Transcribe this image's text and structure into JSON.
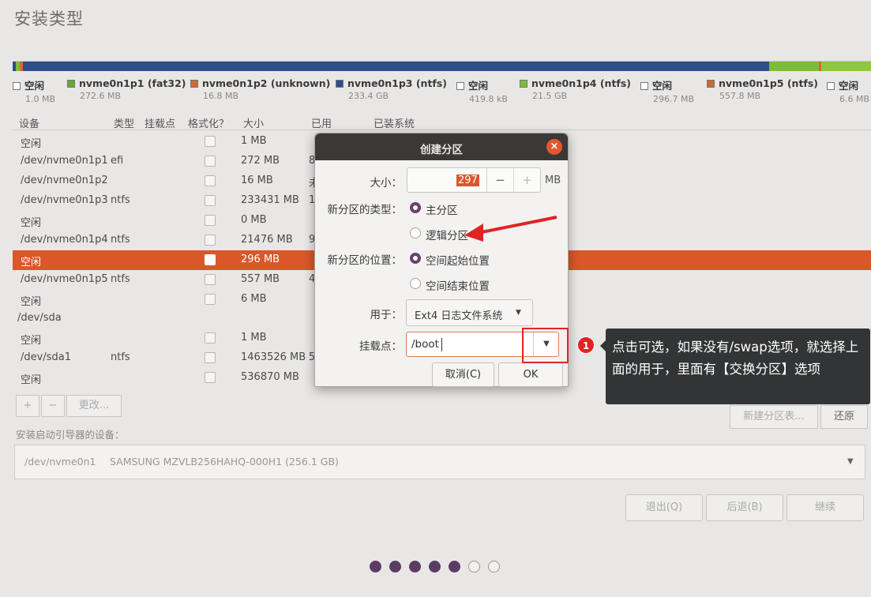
{
  "page_title": "安装类型",
  "partition_bar": [
    {
      "color": "#2d4f8a",
      "weight": 0.4
    },
    {
      "color": "#7bbd3a",
      "weight": 0.5
    },
    {
      "color": "#d06c2e",
      "weight": 0.3
    },
    {
      "color": "#2d4f8a",
      "weight": 90
    },
    {
      "color": "#7bbd3a",
      "weight": 6
    },
    {
      "color": "#d06c2e",
      "weight": 0.3
    },
    {
      "color": "#8ec63f",
      "weight": 6
    }
  ],
  "legend": [
    {
      "name": "空闲",
      "size": "1.0 MB",
      "color": "#ffffff"
    },
    {
      "name": "nvme0n1p1 (fat32)",
      "size": "272.6 MB",
      "color": "#6aa82d"
    },
    {
      "name": "nvme0n1p2 (unknown)",
      "size": "16.8 MB",
      "color": "#cc6a36"
    },
    {
      "name": "nvme0n1p3 (ntfs)",
      "size": "233.4 GB",
      "color": "#2d4f8a"
    },
    {
      "name": "空闲",
      "size": "419.8 kB",
      "color": "#ffffff"
    },
    {
      "name": "nvme0n1p4 (ntfs)",
      "size": "21.5 GB",
      "color": "#7bbd3a"
    },
    {
      "name": "空闲",
      "size": "296.7 MB",
      "color": "#ffffff"
    },
    {
      "name": "nvme0n1p5 (ntfs)",
      "size": "557.8 MB",
      "color": "#cc6a36"
    },
    {
      "name": "空闲",
      "size": "6.6 MB",
      "color": "#ffffff"
    }
  ],
  "table": {
    "headers": [
      "设备",
      "类型",
      "挂载点",
      "格式化？",
      "大小",
      "已用",
      "已装系统"
    ],
    "rows": [
      {
        "device": "空闲",
        "type": "",
        "size": "1 MB",
        "used": ""
      },
      {
        "device": "/dev/nvme0n1p1",
        "type": "efi",
        "size": "272 MB",
        "used": "8"
      },
      {
        "device": "/dev/nvme0n1p2",
        "type": "",
        "size": "16 MB",
        "used": "未"
      },
      {
        "device": "/dev/nvme0n1p3",
        "type": "ntfs",
        "size": "233431 MB",
        "used": "1"
      },
      {
        "device": "空闲",
        "type": "",
        "size": "0 MB",
        "used": ""
      },
      {
        "device": "/dev/nvme0n1p4",
        "type": "ntfs",
        "size": "21476 MB",
        "used": "9"
      },
      {
        "device": "空闲",
        "type": "",
        "size": "296 MB",
        "used": "",
        "selected": true
      },
      {
        "device": "/dev/nvme0n1p5",
        "type": "ntfs",
        "size": "557 MB",
        "used": "4"
      },
      {
        "device": "空闲",
        "type": "",
        "size": "6 MB",
        "used": ""
      },
      {
        "device": "/dev/sda",
        "type": "",
        "size": "",
        "used": "",
        "group": true
      },
      {
        "device": "空闲",
        "type": "",
        "size": "1 MB",
        "used": ""
      },
      {
        "device": "/dev/sda1",
        "type": "ntfs",
        "size": "1463526 MB",
        "used": "5"
      },
      {
        "device": "空闲",
        "type": "",
        "size": "536870 MB",
        "used": ""
      }
    ]
  },
  "table_buttons": {
    "add": "+",
    "remove": "−",
    "change": "更改..."
  },
  "new_table_button": "新建分区表...",
  "revert_button": "还原",
  "boot_loader": {
    "label": "安装启动引导器的设备：",
    "device": "/dev/nvme0n1",
    "model": "SAMSUNG MZVLB256HAHQ-000H1 (256.1 GB)"
  },
  "nav": {
    "quit": "退出(Q)",
    "back": "后退(B)",
    "continue": "继续"
  },
  "progress": {
    "done": 5,
    "total": 7
  },
  "dialog": {
    "title": "创建分区",
    "size_label": "大小：",
    "size_value": "297",
    "size_unit": "MB",
    "type_label": "新分区的类型：",
    "type_primary": "主分区",
    "type_logical": "逻辑分区",
    "location_label": "新分区的位置：",
    "location_start": "空间起始位置",
    "location_end": "空间结束位置",
    "use_label": "用于：",
    "use_value": "Ext4 日志文件系统",
    "mount_label": "挂载点：",
    "mount_value": "/boot",
    "cancel": "取消(C)",
    "ok": "OK"
  },
  "annotation": {
    "badge": "1",
    "text": "点击可选，如果没有/swap选项，就选择上面的用于，里面有【交换分区】选项"
  }
}
